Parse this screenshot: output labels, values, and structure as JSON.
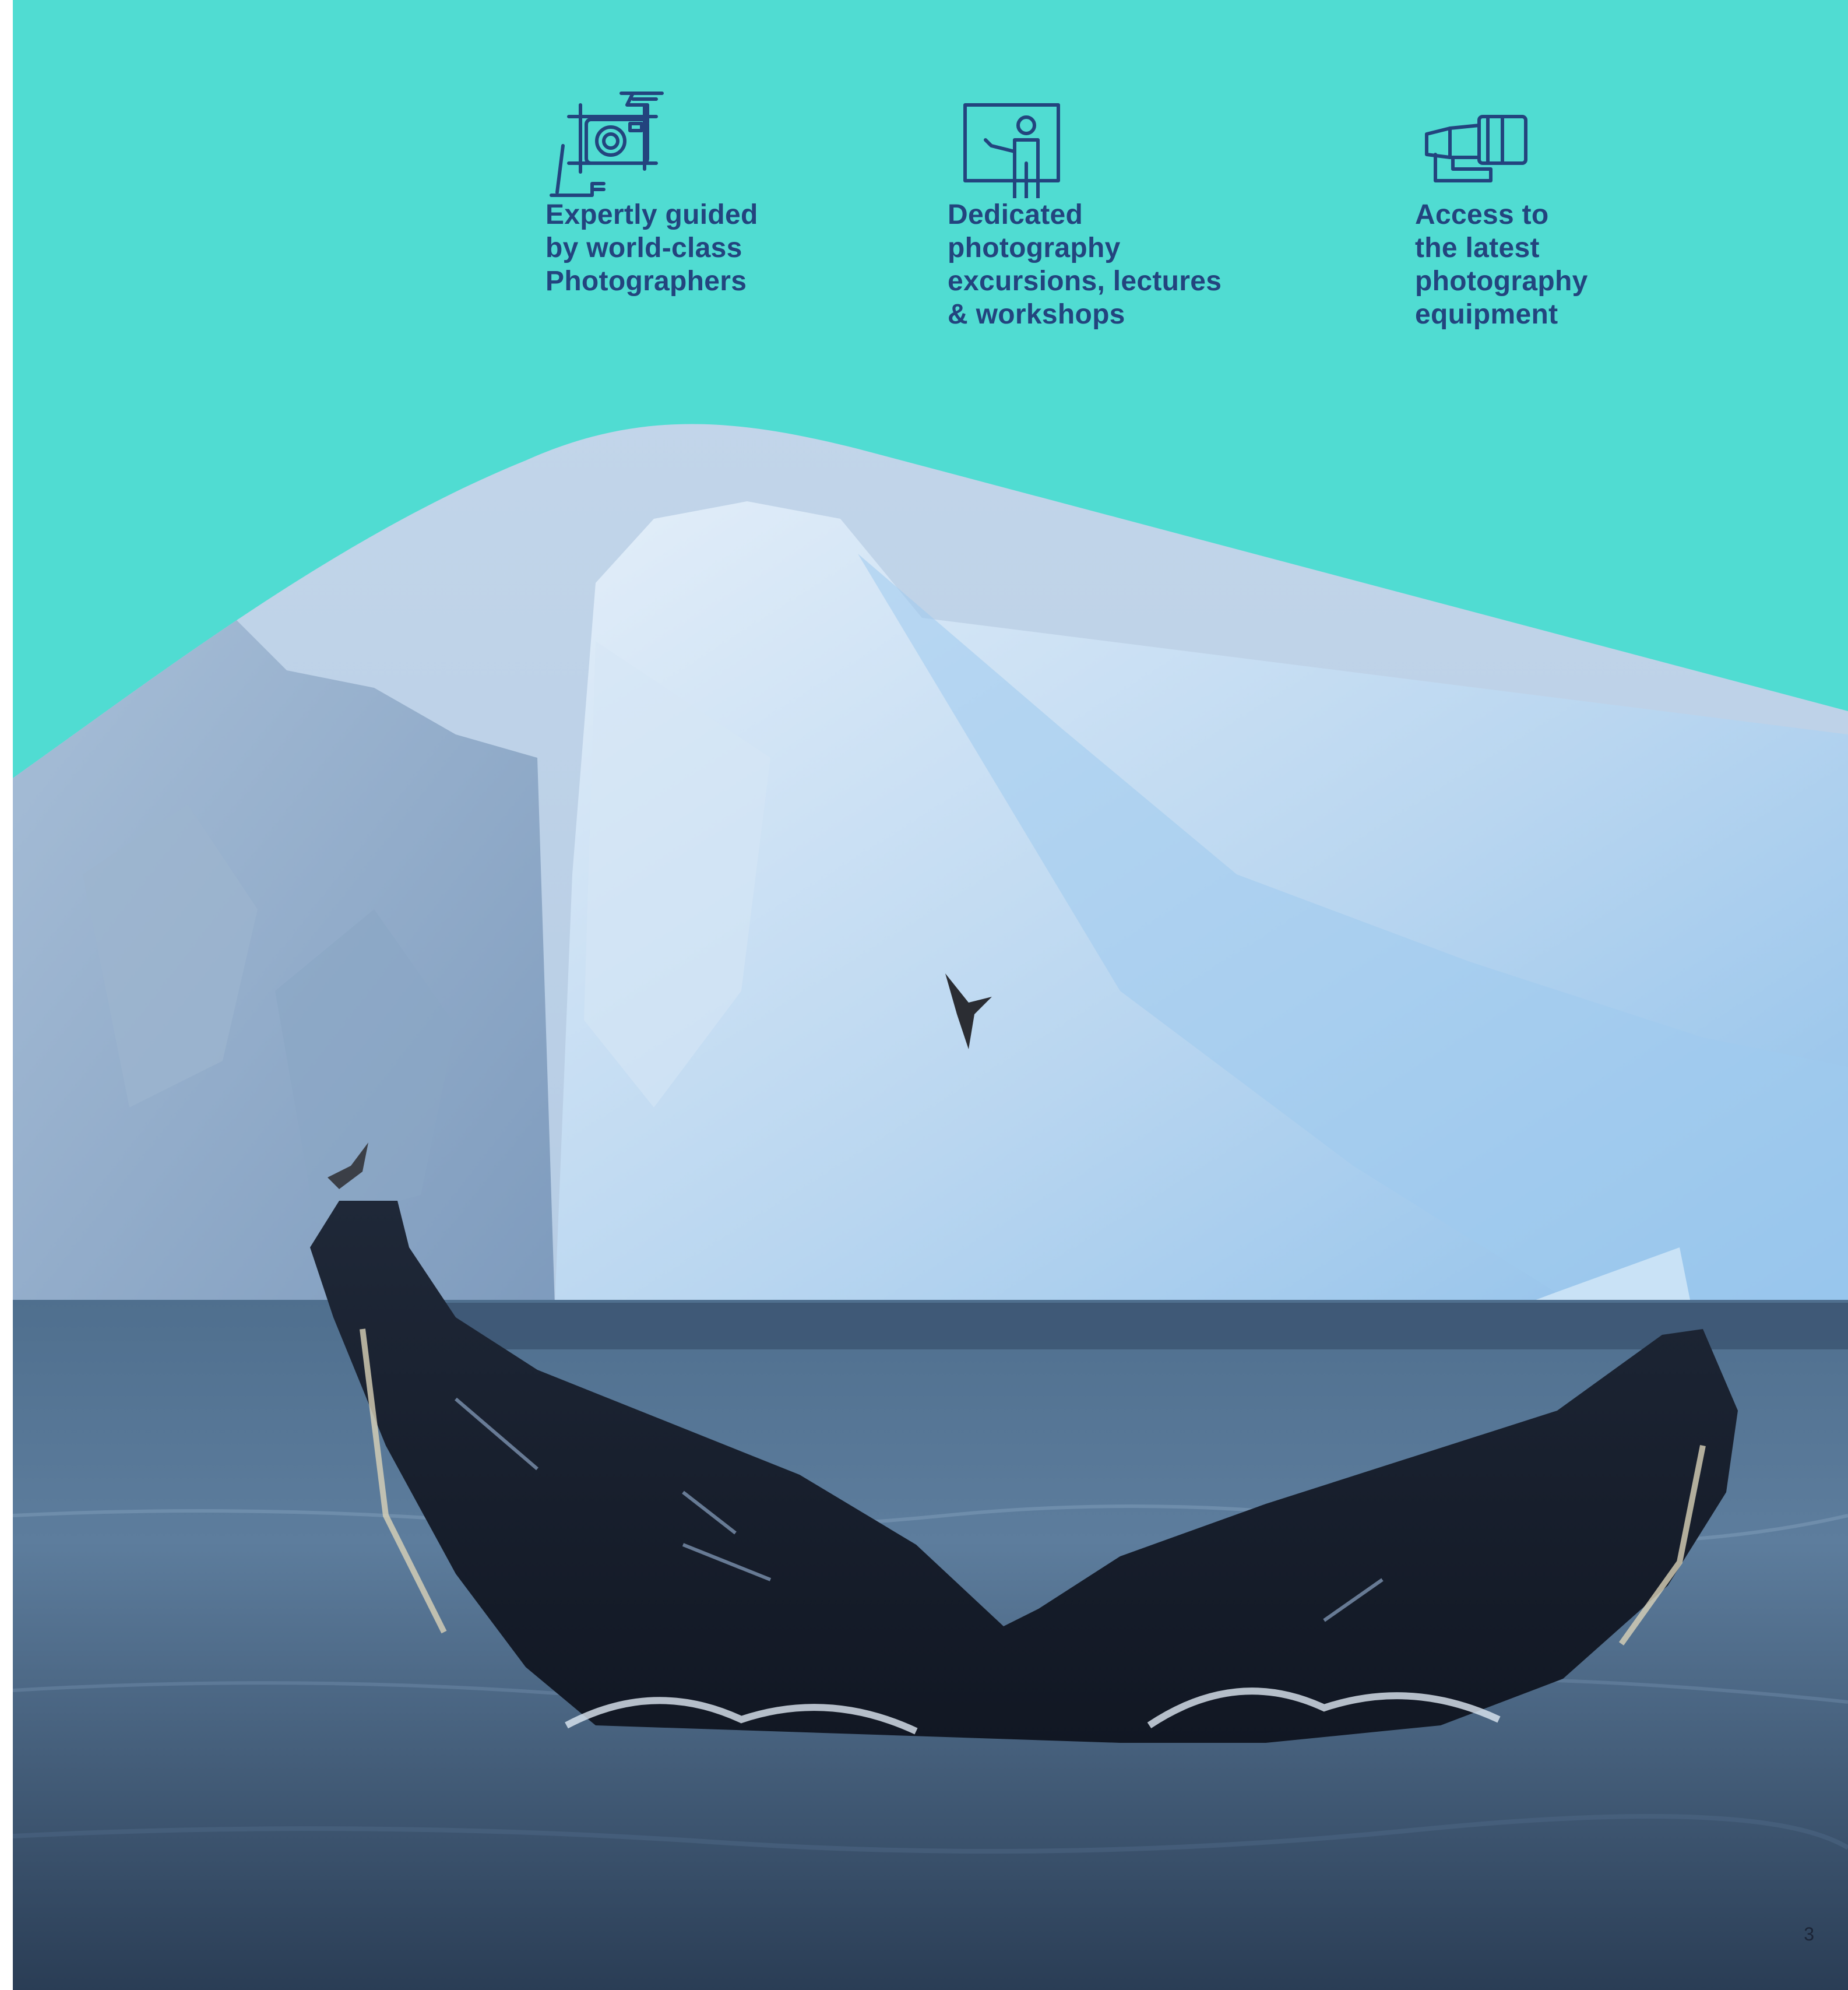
{
  "features": [
    {
      "icon": "camera-framing-icon",
      "lines": [
        "Expertly guided",
        "by world-class",
        "Photographers"
      ]
    },
    {
      "icon": "presenter-board-icon",
      "lines": [
        "Dedicated",
        "photography",
        "excursions, lectures",
        "& workshops"
      ]
    },
    {
      "icon": "telephoto-lens-icon",
      "lines": [
        "Access to",
        "the latest",
        "photography",
        "equipment"
      ]
    }
  ],
  "page_number": "3",
  "colors": {
    "background": "#50dcd2",
    "text": "#23447e"
  }
}
